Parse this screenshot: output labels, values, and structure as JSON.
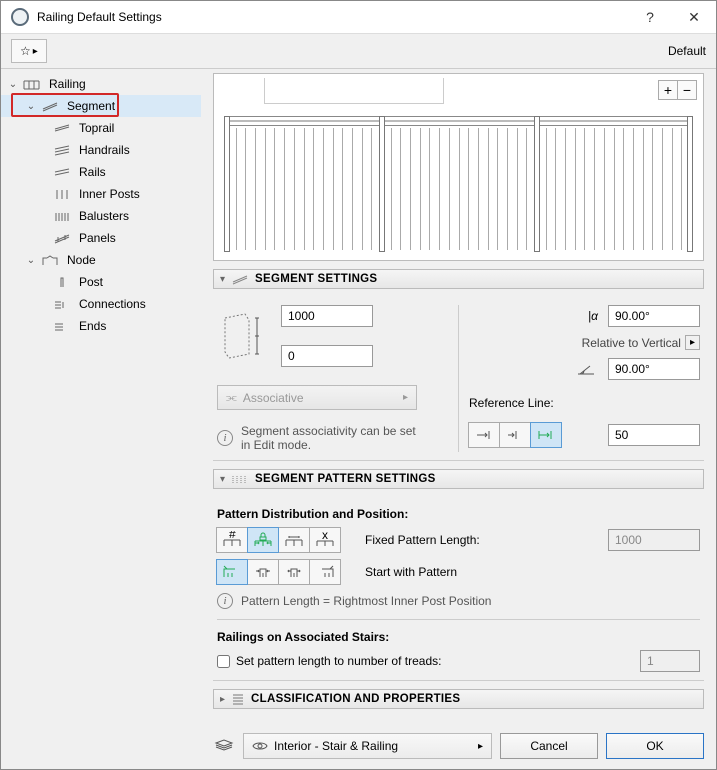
{
  "window": {
    "title": "Railing Default Settings"
  },
  "toolbar": {
    "mode": "Default"
  },
  "tree": {
    "railing": "Railing",
    "segment": "Segment",
    "toprail": "Toprail",
    "handrails": "Handrails",
    "rails": "Rails",
    "inner_posts": "Inner Posts",
    "balusters": "Balusters",
    "panels": "Panels",
    "node": "Node",
    "post": "Post",
    "connections": "Connections",
    "ends": "Ends"
  },
  "seg": {
    "header": "SEGMENT SETTINGS",
    "height": "1000",
    "offset": "0",
    "angle1": "90.00°",
    "angle2": "90.00°",
    "relative": "Relative to Vertical",
    "assoc_btn": "Associative",
    "assoc_hint": "Segment associativity can be set in Edit mode.",
    "ref_line": "Reference Line:",
    "ref_offset": "50"
  },
  "pat": {
    "header": "SEGMENT PATTERN SETTINGS",
    "dist_label": "Pattern Distribution and Position:",
    "fixed_len_label": "Fixed Pattern Length:",
    "fixed_len": "1000",
    "start_with": "Start with Pattern",
    "length_hint": "Pattern Length = Rightmost Inner Post Position",
    "stairs_label": "Railings on Associated Stairs:",
    "treads_check": "Set pattern length to number of treads:",
    "treads_val": "1"
  },
  "cls": {
    "header": "CLASSIFICATION AND PROPERTIES"
  },
  "footer": {
    "layer": "Interior - Stair & Railing",
    "cancel": "Cancel",
    "ok": "OK"
  }
}
